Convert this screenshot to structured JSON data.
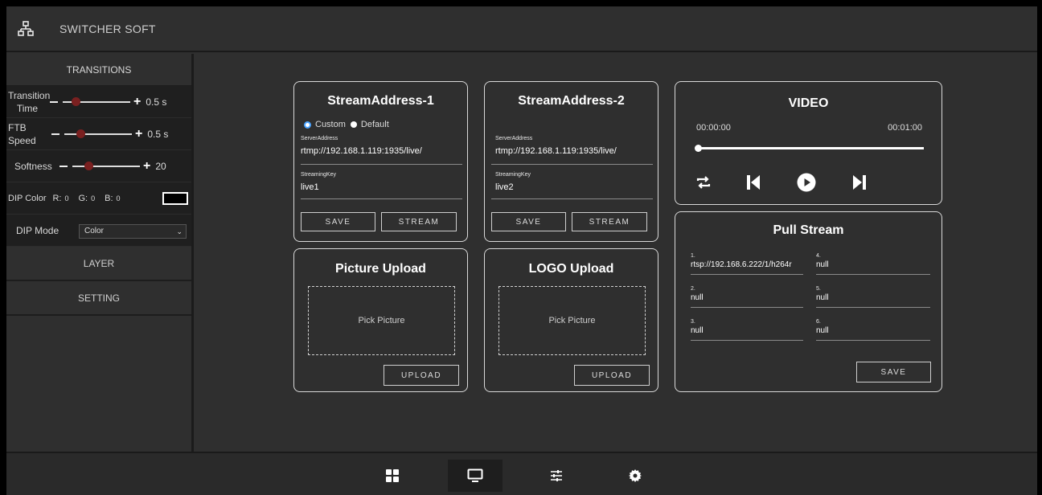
{
  "app": {
    "title": "SWITCHER SOFT"
  },
  "sidebar": {
    "transitions_label": "TRANSITIONS",
    "transition_time": {
      "label": "Transition Time",
      "value": "0.5 s",
      "level": 0.15
    },
    "ftb_speed": {
      "label": "FTB Speed",
      "value": "0.5 s",
      "level": 0.2
    },
    "softness": {
      "label": "Softness",
      "value": "20",
      "level": 0.2
    },
    "dip_color": {
      "label": "DIP Color",
      "r_label": "R:",
      "r": "0",
      "g_label": "G:",
      "g": "0",
      "b_label": "B:",
      "b": "0",
      "swatch": "#000000"
    },
    "dip_mode": {
      "label": "DIP Mode",
      "selected": "Color"
    },
    "layer_label": "LAYER",
    "setting_label": "SETTING"
  },
  "stream1": {
    "title": "StreamAddress-1",
    "custom_label": "Custom",
    "default_label": "Default",
    "server_label": "ServerAddress",
    "server_value": "rtmp://192.168.1.119:1935/live/",
    "key_label": "StreamingKey",
    "key_value": "live1",
    "save": "SAVE",
    "stream": "STREAM"
  },
  "stream2": {
    "title": "StreamAddress-2",
    "server_label": "ServerAddress",
    "server_value": "rtmp://192.168.1.119:1935/live/",
    "key_label": "StreamingKey",
    "key_value": "live2",
    "save": "SAVE",
    "stream": "STREAM"
  },
  "video": {
    "title": "VIDEO",
    "time_start": "00:00:00",
    "time_end": "00:01:00",
    "progress": 0
  },
  "picture_upload": {
    "title": "Picture Upload",
    "pick": "Pick Picture",
    "upload": "UPLOAD"
  },
  "logo_upload": {
    "title": "LOGO Upload",
    "pick": "Pick Picture",
    "upload": "UPLOAD"
  },
  "pull_stream": {
    "title": "Pull Stream",
    "items": [
      {
        "num": "1.",
        "value": "rtsp://192.168.6.222/1/h264r"
      },
      {
        "num": "2.",
        "value": "null"
      },
      {
        "num": "3.",
        "value": "null"
      },
      {
        "num": "4.",
        "value": "null"
      },
      {
        "num": "5.",
        "value": "null"
      },
      {
        "num": "6.",
        "value": "null"
      }
    ],
    "save": "SAVE"
  },
  "colors": {
    "panel_border": "#d9d9d9",
    "knob": "#7a2020",
    "radio_active": "#4aa3ff"
  },
  "bottom_icons": [
    "grid-icon",
    "monitor-icon",
    "sliders-icon",
    "gear-icon"
  ]
}
